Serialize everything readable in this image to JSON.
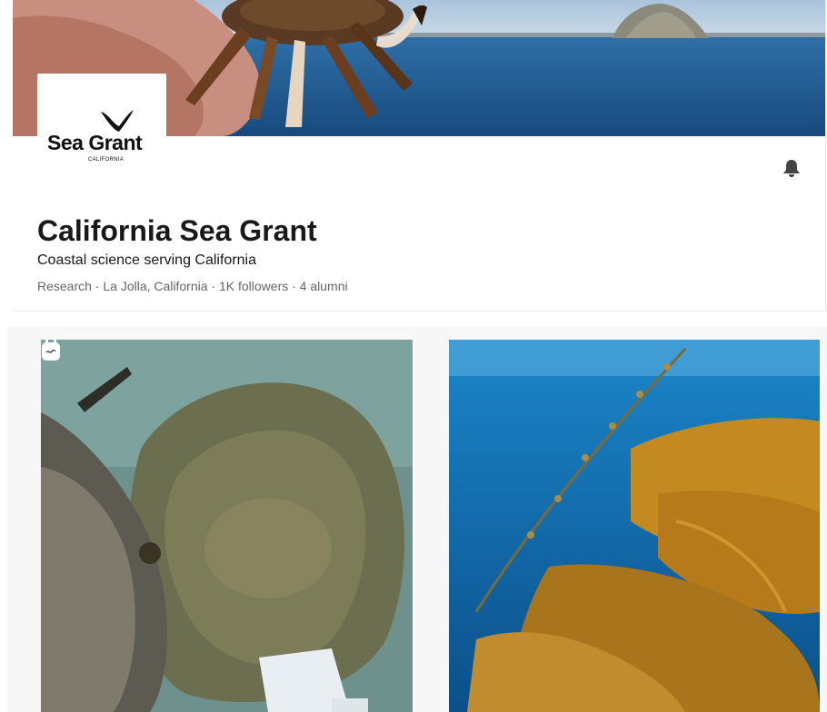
{
  "company": {
    "logo_text": "Sea Grant",
    "logo_subtext": "CALIFORNIA",
    "name": "California Sea Grant",
    "tagline": "Coastal science serving California",
    "meta": "Research · La Jolla, California · 1K followers · 4 alumni"
  },
  "icons": {
    "notify": "bell-icon",
    "story": "story-badge-icon"
  },
  "colors": {
    "text_primary": "#191919",
    "text_secondary": "#666666",
    "icon": "#444444"
  }
}
